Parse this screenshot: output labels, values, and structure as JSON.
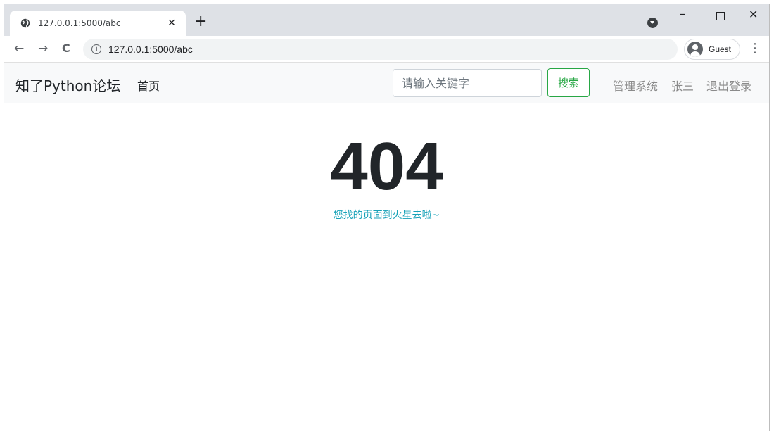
{
  "browser": {
    "tab": {
      "title": "127.0.0.1:5000/abc",
      "favicon": "globe-icon"
    },
    "new_tab_label": "+",
    "minimize_label": "–",
    "close_label": "✕",
    "tab_close_label": "✕",
    "address": "127.0.0.1:5000/abc",
    "profile_label": "Guest",
    "nav": {
      "back": "←",
      "forward": "→",
      "reload": "C"
    },
    "menu_label": "⋮"
  },
  "site": {
    "brand": "知了Python论坛",
    "home_link": "首页",
    "search": {
      "placeholder": "请输入关键字",
      "button_label": "搜索"
    },
    "right_links": {
      "admin": "管理系统",
      "user": "张三",
      "logout": "退出登录"
    }
  },
  "error": {
    "code": "404",
    "message": "您找的页面到火星去啦~"
  },
  "colors": {
    "success": "#28a745",
    "info": "#17a2b8",
    "navbar_bg": "#f8f9fa",
    "tabstrip_bg": "#dee1e6"
  }
}
